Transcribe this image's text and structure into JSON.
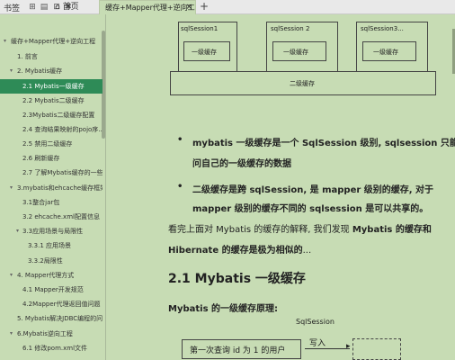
{
  "topbar": {
    "label": "书签",
    "home_tab": "首页",
    "doc_tab": "缓存+Mapper代理+逆向工程...",
    "add_tab": "+"
  },
  "sidebar": {
    "items": [
      {
        "label": "缓存+Mapper代理+逆向工程",
        "arrow": "▾"
      },
      {
        "label": "1. 前言",
        "arrow": ""
      },
      {
        "label": "2. Mybatis缓存",
        "arrow": "▾"
      },
      {
        "label": "2.1 Mybatis一级缓存",
        "arrow": ""
      },
      {
        "label": "2.2 Mybatis二级缓存",
        "arrow": ""
      },
      {
        "label": "2.3Mybatis二级缓存配置",
        "arrow": ""
      },
      {
        "label": "2.4 查询结果映射的pojo序...",
        "arrow": ""
      },
      {
        "label": "2.5 禁用二级缓存",
        "arrow": ""
      },
      {
        "label": "2.6 刷新缓存",
        "arrow": ""
      },
      {
        "label": "2.7 了解Mybatis缓存的一些...",
        "arrow": ""
      },
      {
        "label": "3.mybatis和ehcache缓存框架...",
        "arrow": "▾"
      },
      {
        "label": "3.1整合jar包",
        "arrow": ""
      },
      {
        "label": "3.2 ehcache.xml配置信息",
        "arrow": ""
      },
      {
        "label": "3.3应用场景与局限性",
        "arrow": "▾"
      },
      {
        "label": "3.3.1 应用场景",
        "arrow": ""
      },
      {
        "label": "3.3.2局限性",
        "arrow": ""
      },
      {
        "label": "4. Mapper代理方式",
        "arrow": "▾"
      },
      {
        "label": "4.1 Mapper开发规范",
        "arrow": ""
      },
      {
        "label": "4.2Mapper代理返回值问题",
        "arrow": ""
      },
      {
        "label": "5. Mybatis解决JDBC编程的问...",
        "arrow": ""
      },
      {
        "label": "6.Mybatis逆向工程",
        "arrow": "▾"
      },
      {
        "label": "6.1 修改pom.xml文件",
        "arrow": ""
      }
    ]
  },
  "diagram1": {
    "sessions": [
      "sqlSession1",
      "sqlSession 2",
      "sqlSession3..."
    ],
    "first_cache": "一级缓存",
    "second_cache": "二级缓存"
  },
  "content": {
    "bullet1_l1": "mybatis 一级缓存是一个 SqlSession 级别, sqlsession 只能访",
    "bullet1_l2": "问自己的一级缓存的数据",
    "bullet2_l1": "二级缓存是跨 sqlSession, 是 mapper 级别的缓存, 对于",
    "bullet2_l2": "mapper 级别的缓存不同的 sqlsession 是可以共享的。",
    "para_l1_a": "看完上面对 Mybatis 的缓存的解释, 我们发现 ",
    "para_l1_b": "Mybatis 的缓存和",
    "para_l2_a": "Hibernate 的缓存是极为相似的",
    "para_l2_b": "...",
    "heading": "2.1 Mybatis 一级缓存",
    "subheading": "Mybatis 的一级缓存原理:",
    "diagram2_title": "SqlSession",
    "query_box": "第一次查询 id 为 1 的用户",
    "write_label": "写入"
  }
}
